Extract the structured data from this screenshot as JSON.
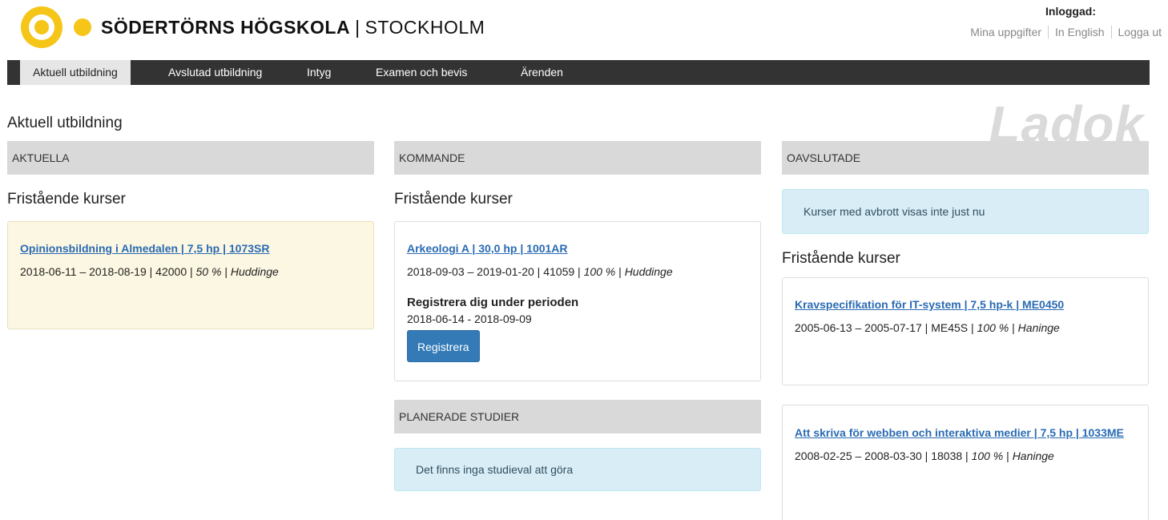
{
  "brand": {
    "name": "SÖDERTÖRNS HÖGSKOLA",
    "separator": "|",
    "city": "STOCKHOLM"
  },
  "user": {
    "logged_in_label": "Inloggad:",
    "links": [
      "Mina uppgifter",
      "In English",
      "Logga ut"
    ]
  },
  "nav": {
    "items": [
      "Aktuell utbildning",
      "Avslutad utbildning",
      "Intyg",
      "Examen och bevis",
      "Ärenden"
    ],
    "active": "Aktuell utbildning"
  },
  "page": {
    "title": "Aktuell utbildning",
    "watermark": "Ladok"
  },
  "aktuella": {
    "heading": "AKTUELLA",
    "subtitle": "Fristående kurser",
    "course": {
      "link": "Opinionsbildning i Almedalen | 7,5 hp | 1073SR",
      "dates": "2018-06-11 – 2018-08-19 | 42000 | ",
      "pace": "50 %",
      "sep": " | ",
      "location": "Huddinge"
    }
  },
  "kommande": {
    "heading": "KOMMANDE",
    "subtitle": "Fristående kurser",
    "course": {
      "link": "Arkeologi A | 30,0 hp | 1001AR",
      "dates": "2018-09-03 – 2019-01-20 | 41059 | ",
      "pace": "100 %",
      "sep": " | ",
      "location": "Huddinge",
      "register_heading": "Registrera dig under perioden",
      "register_period": "2018-06-14 - 2018-09-09",
      "register_button": "Registrera"
    }
  },
  "planerade": {
    "heading": "PLANERADE STUDIER",
    "info": "Det finns inga studieval att göra"
  },
  "oavslutade": {
    "heading": "OAVSLUTADE",
    "info": "Kurser med avbrott visas inte just nu",
    "subtitle": "Fristående kurser",
    "courses": [
      {
        "link": "Kravspecifikation för IT-system | 7,5 hp-k | ME0450",
        "dates": "2005-06-13 – 2005-07-17 | ME45S | ",
        "pace": "100 %",
        "sep": " | ",
        "location": "Haninge"
      },
      {
        "link": "Att skriva för webben och interaktiva medier | 7,5 hp | 1033ME",
        "dates": "2008-02-25 – 2008-03-30 | 18038 | ",
        "pace": "100 %",
        "sep": " | ",
        "location": "Haninge"
      }
    ]
  },
  "colors": {
    "brand_yellow": "#f5c518",
    "nav_dark": "#333333",
    "link_blue": "#2a6bb3",
    "button_blue": "#337ab7",
    "info_bg": "#d9edf7",
    "highlight_card": "#fcf7e2"
  }
}
